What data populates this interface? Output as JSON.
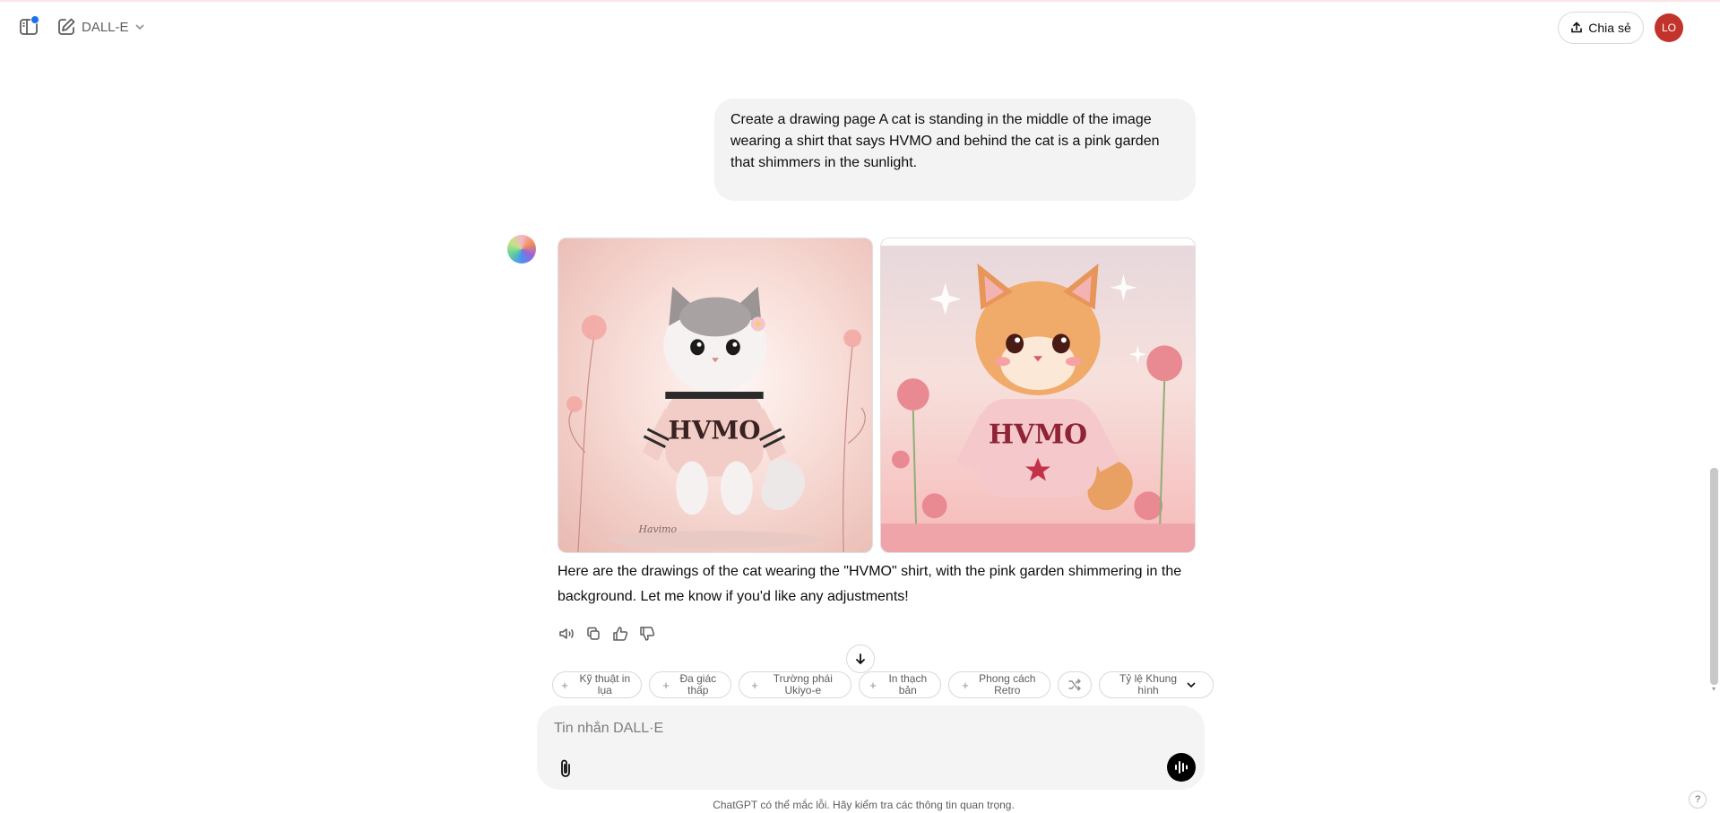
{
  "header": {
    "model_name": "DALL-E",
    "share_label": "Chia sẻ",
    "avatar_initials": "LO"
  },
  "conversation": {
    "user_message": "Create a drawing page A cat is standing in the middle of the image wearing a shirt that says HVMO and behind the cat is a pink garden that shimmers in the sunlight.",
    "assistant_message": "Here are the drawings of the cat wearing the \"HVMO\" shirt, with the pink garden shimmering in the background. Let me know if you'd like any adjustments!",
    "images": [
      {
        "shirt_text": "HVMO",
        "signature": "Havimo"
      },
      {
        "shirt_text": "HVMO"
      }
    ]
  },
  "style_chips": [
    {
      "label": "Kỹ thuật in lụa"
    },
    {
      "label": "Đa giác thấp"
    },
    {
      "label": "Trường phái Ukiyo-e"
    },
    {
      "label": "In thạch bản"
    },
    {
      "label": "Phong cách Retro"
    },
    {
      "label": "Tỷ lệ Khung hình"
    }
  ],
  "composer": {
    "placeholder": "Tin nhắn DALL·E"
  },
  "footer": {
    "disclaimer": "ChatGPT có thể mắc lỗi. Hãy kiểm tra các thông tin quan trọng.",
    "help_label": "?"
  },
  "colors": {
    "accent_dot": "#1a73e8",
    "avatar_bg": "#c2332c",
    "bubble_bg": "#f3f3f3",
    "composer_bg": "#f4f4f4"
  }
}
